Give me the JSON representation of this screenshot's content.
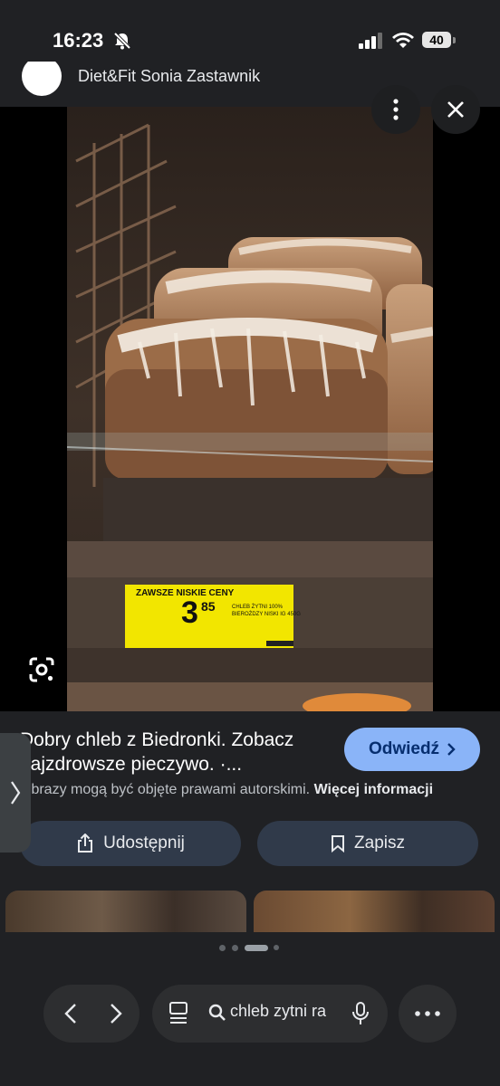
{
  "status_bar": {
    "time": "16:23",
    "battery": "40"
  },
  "source": {
    "name": "Diet&Fit Sonia Zastawnik"
  },
  "photo": {
    "price_tag": {
      "header": "ZAWSZE NISKIE CENY",
      "price_main": "3",
      "price_cents": "85",
      "product_line1": "CHLEB ŻYTNI 100%",
      "product_line2": "BIEROŻDZY NISKI IG 450G"
    }
  },
  "result": {
    "title": "Dobry chleb z Biedronki. Zobacz najzdrowsze pieczywo. ·...",
    "visit_label": "Odwiedź",
    "copyright_text": "Obrazy mogą być objęte prawami autorskimi.",
    "copyright_link": "Więcej informacji",
    "share_label": "Udostępnij",
    "save_label": "Zapisz"
  },
  "toolbar": {
    "search_query": "chleb zytni ra"
  },
  "colors": {
    "background": "#202124",
    "accent": "#8ab4f8",
    "button": "#303a4a"
  },
  "icons": [
    "bell-slash-icon",
    "signal-icon",
    "wifi-icon",
    "more-vert-icon",
    "close-icon",
    "lens-icon",
    "chevron-right-icon",
    "share-icon",
    "bookmark-icon",
    "back-icon",
    "forward-icon",
    "tabs-icon",
    "search-icon",
    "mic-icon",
    "more-horiz-icon"
  ]
}
